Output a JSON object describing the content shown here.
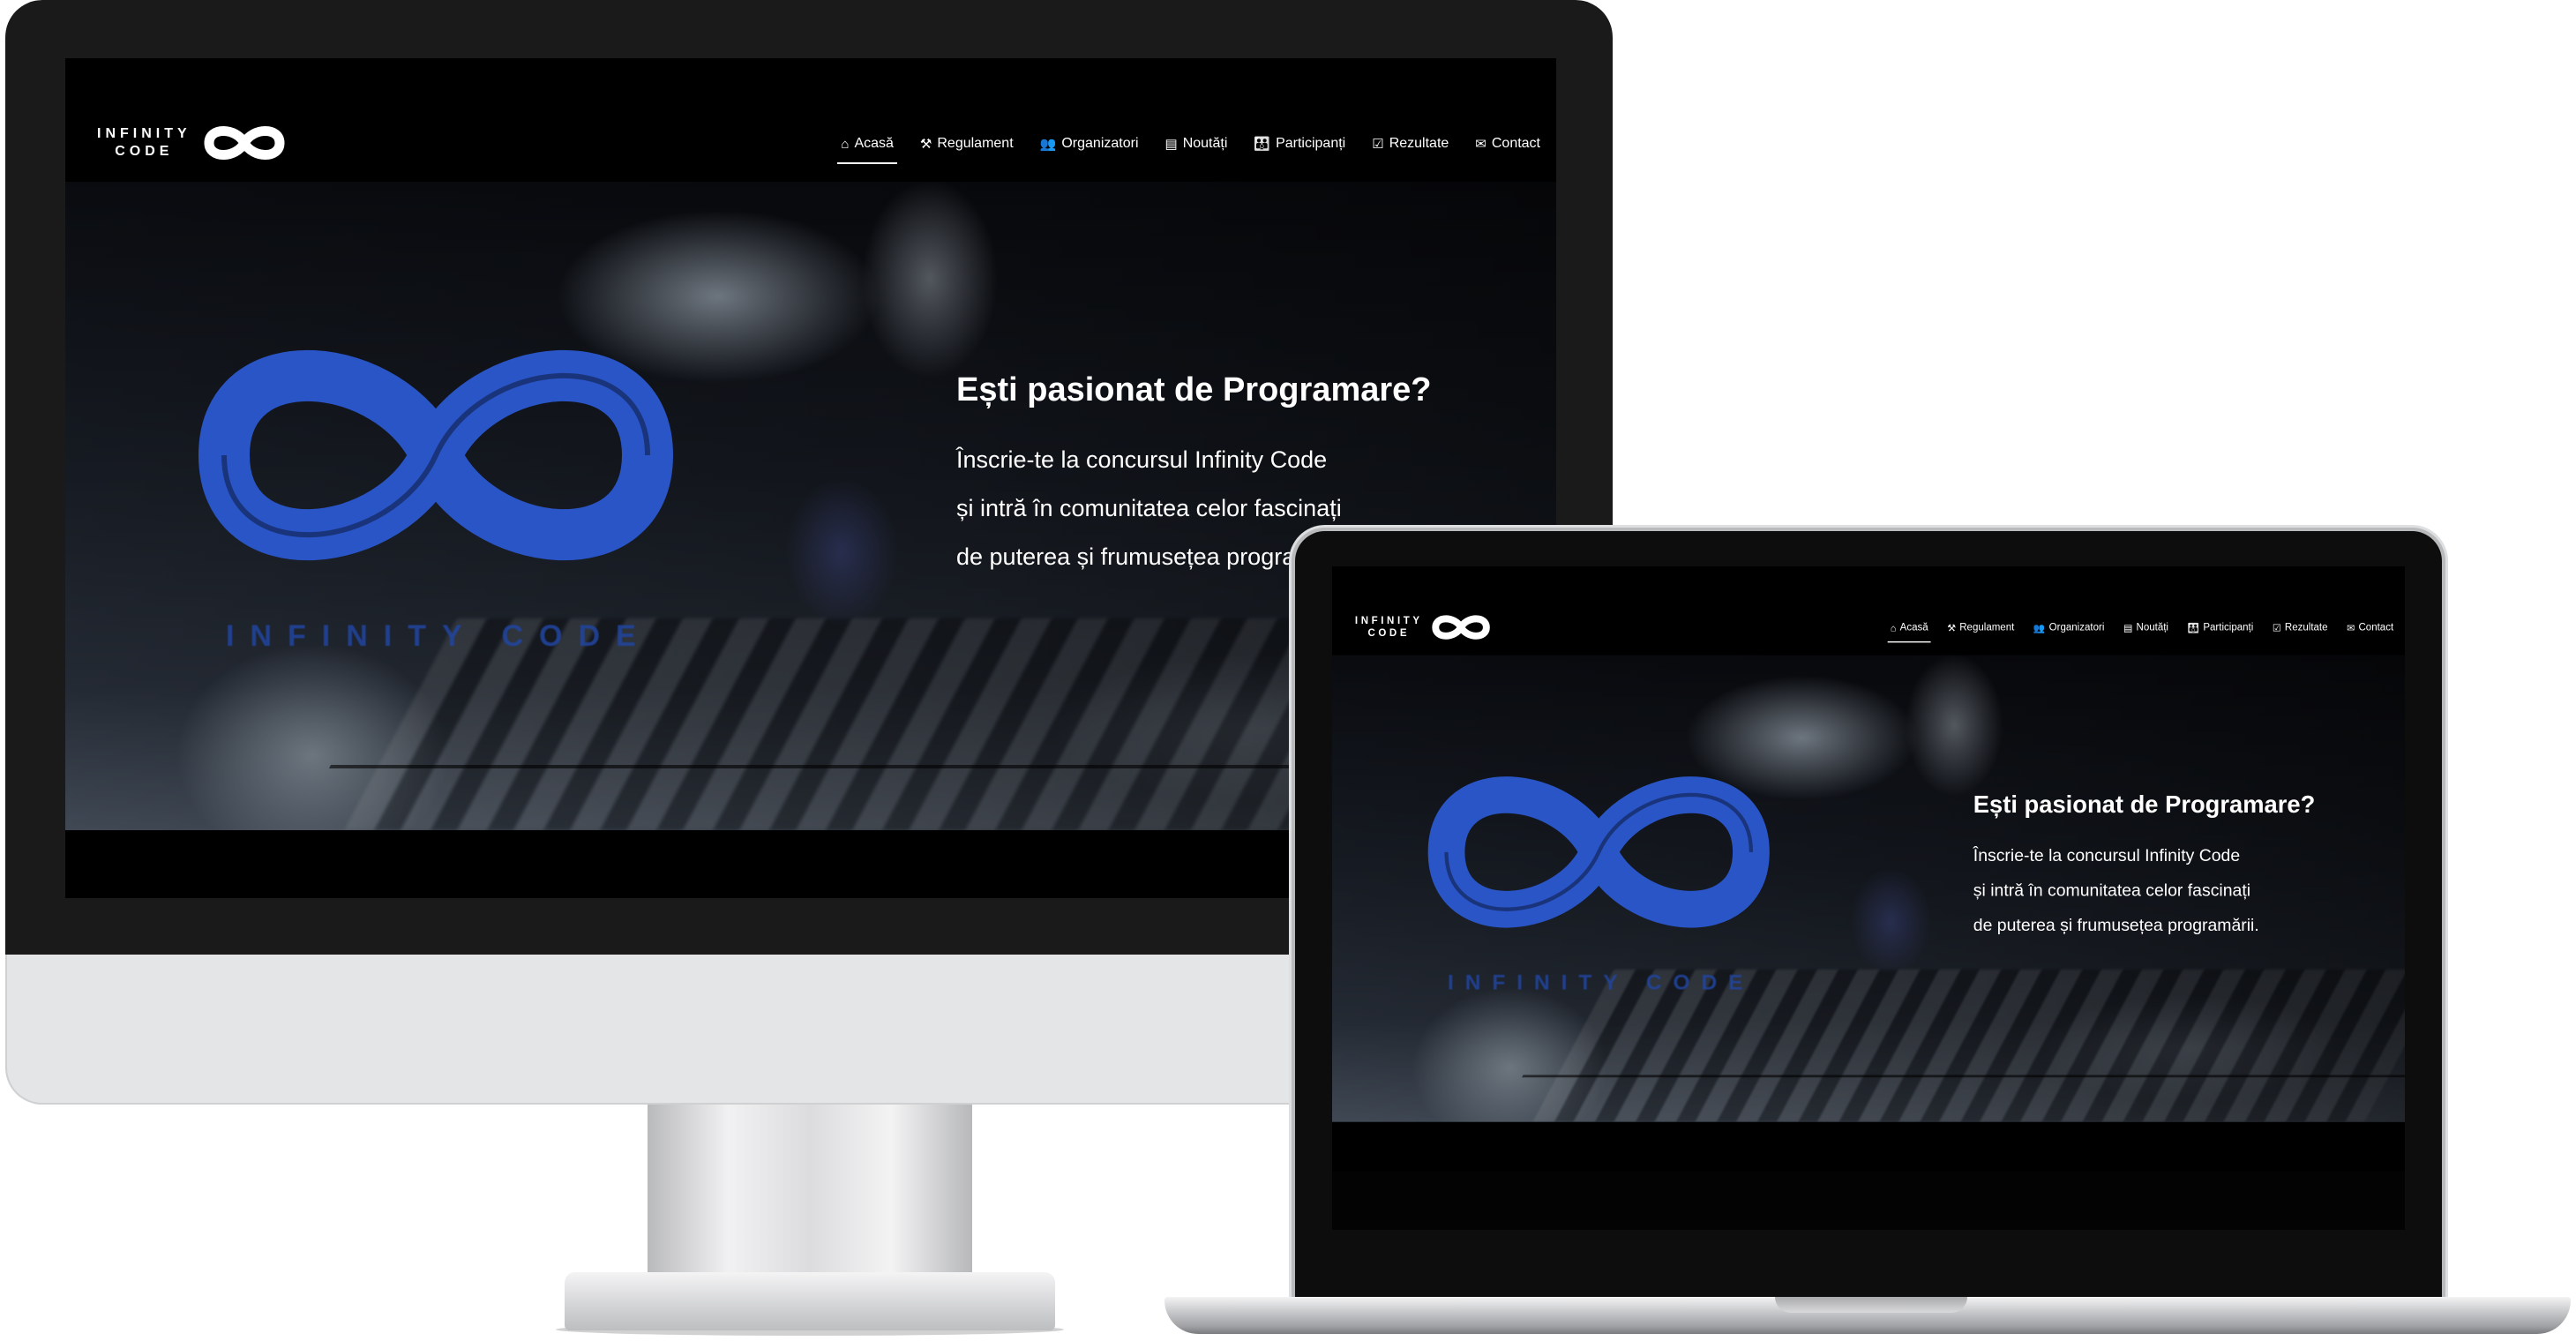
{
  "site": {
    "logo_word_top": "INFINITY",
    "logo_word_bottom": "CODE",
    "hero_logo_word": "INFINITY CODE",
    "headline": "Ești pasionat de Programare?",
    "paragraph_lines": [
      "Înscrie-te la concursul Infinity Code",
      "și intră în comunitatea celor fascinați",
      "de puterea și frumusețea programării."
    ],
    "nav": [
      {
        "label": "Acasă",
        "icon": "home-icon",
        "active": true
      },
      {
        "label": "Regulament",
        "icon": "gavel-icon",
        "active": false
      },
      {
        "label": "Organizatori",
        "icon": "users-icon",
        "active": false
      },
      {
        "label": "Noutăți",
        "icon": "newspaper-icon",
        "active": false
      },
      {
        "label": "Participanți",
        "icon": "group-icon",
        "active": false
      },
      {
        "label": "Rezultate",
        "icon": "calendar-check-icon",
        "active": false
      },
      {
        "label": "Contact",
        "icon": "envelope-icon",
        "active": false
      }
    ],
    "colors": {
      "accent_blue": "#2a55c7",
      "background": "#000000",
      "text": "#ffffff"
    }
  }
}
